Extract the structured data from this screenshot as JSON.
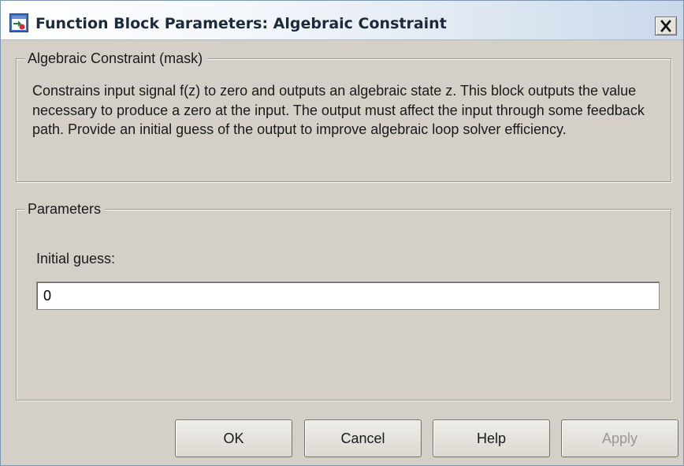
{
  "window": {
    "title": "Function Block Parameters: Algebraic Constraint",
    "close_label": "✕"
  },
  "mask_group": {
    "label": "Algebraic Constraint (mask)",
    "description": "Constrains input signal f(z) to zero and outputs an algebraic state z. This block outputs the value necessary to produce a zero at the input. The output must affect the input through some feedback path. Provide an initial guess of the output to improve algebraic loop solver efficiency."
  },
  "parameters_group": {
    "label": "Parameters",
    "initial_guess": {
      "label": "Initial guess:",
      "value": "0"
    }
  },
  "buttons": {
    "ok": "OK",
    "cancel": "Cancel",
    "help": "Help",
    "apply": "Apply",
    "apply_enabled": false
  },
  "icons": {
    "app": "simulink-block-icon",
    "close": "close-icon"
  }
}
